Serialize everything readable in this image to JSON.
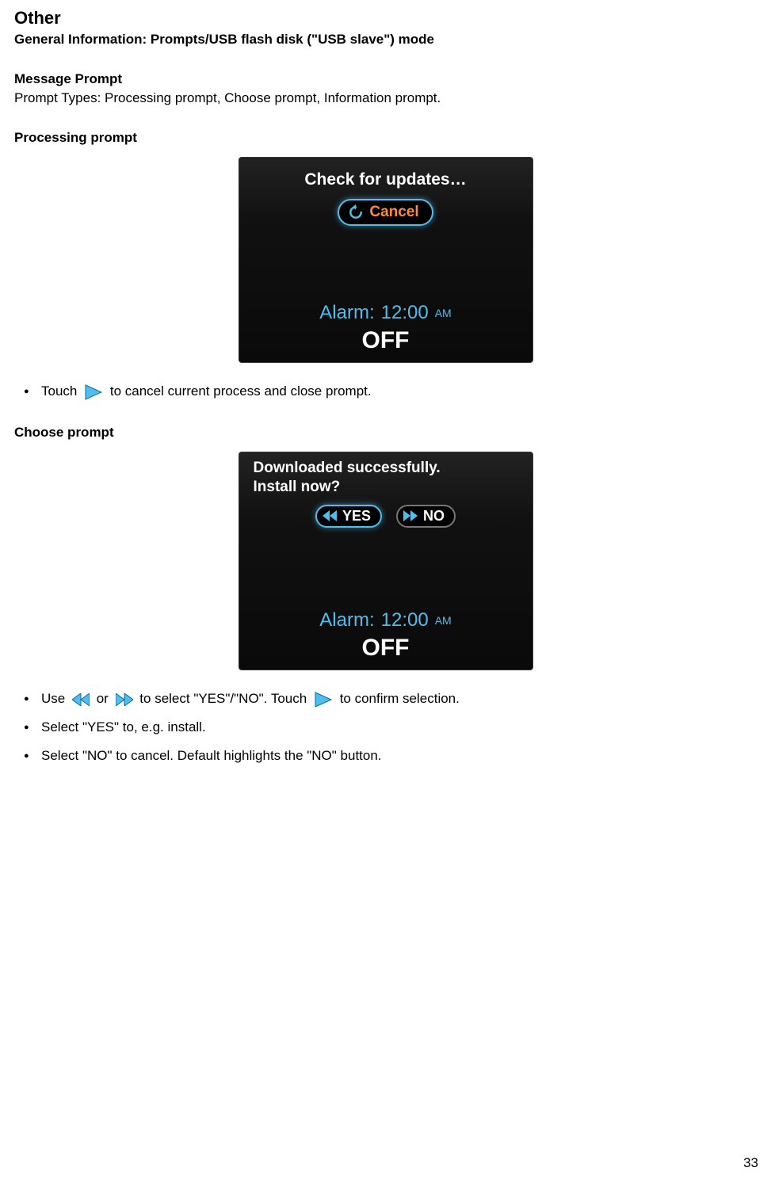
{
  "heading": "Other",
  "subheading": "General Information: Prompts/USB flash disk (\"USB slave\") mode",
  "message_prompt_heading": "Message Prompt",
  "message_prompt_text": "Prompt Types: Processing prompt, Choose prompt, Information prompt.",
  "processing_heading": "Processing prompt",
  "processing_screenshot": {
    "title": "Check for updates…",
    "cancel_label": "Cancel",
    "alarm_label": "Alarm:",
    "alarm_time": "12:00",
    "alarm_ampm": "AM",
    "off": "OFF"
  },
  "processing_bullets": {
    "touch_pre": "Touch",
    "touch_post": "to cancel current process and close prompt."
  },
  "choose_heading": "Choose prompt",
  "choose_screenshot": {
    "line1": "Downloaded successfully.",
    "line2": "Install now?",
    "yes_label": "YES",
    "no_label": "NO",
    "alarm_label": "Alarm:",
    "alarm_time": "12:00",
    "alarm_ampm": "AM",
    "off": "OFF"
  },
  "choose_bullets": {
    "use_pre": "Use",
    "use_mid": "or",
    "use_post1": "to select \"YES\"/\"NO\". Touch",
    "use_post2": "to confirm selection.",
    "b2": "Select \"YES\" to, e.g. install.",
    "b3": "Select \"NO\" to cancel. Default highlights the \"NO\" button."
  },
  "page_number": "33"
}
